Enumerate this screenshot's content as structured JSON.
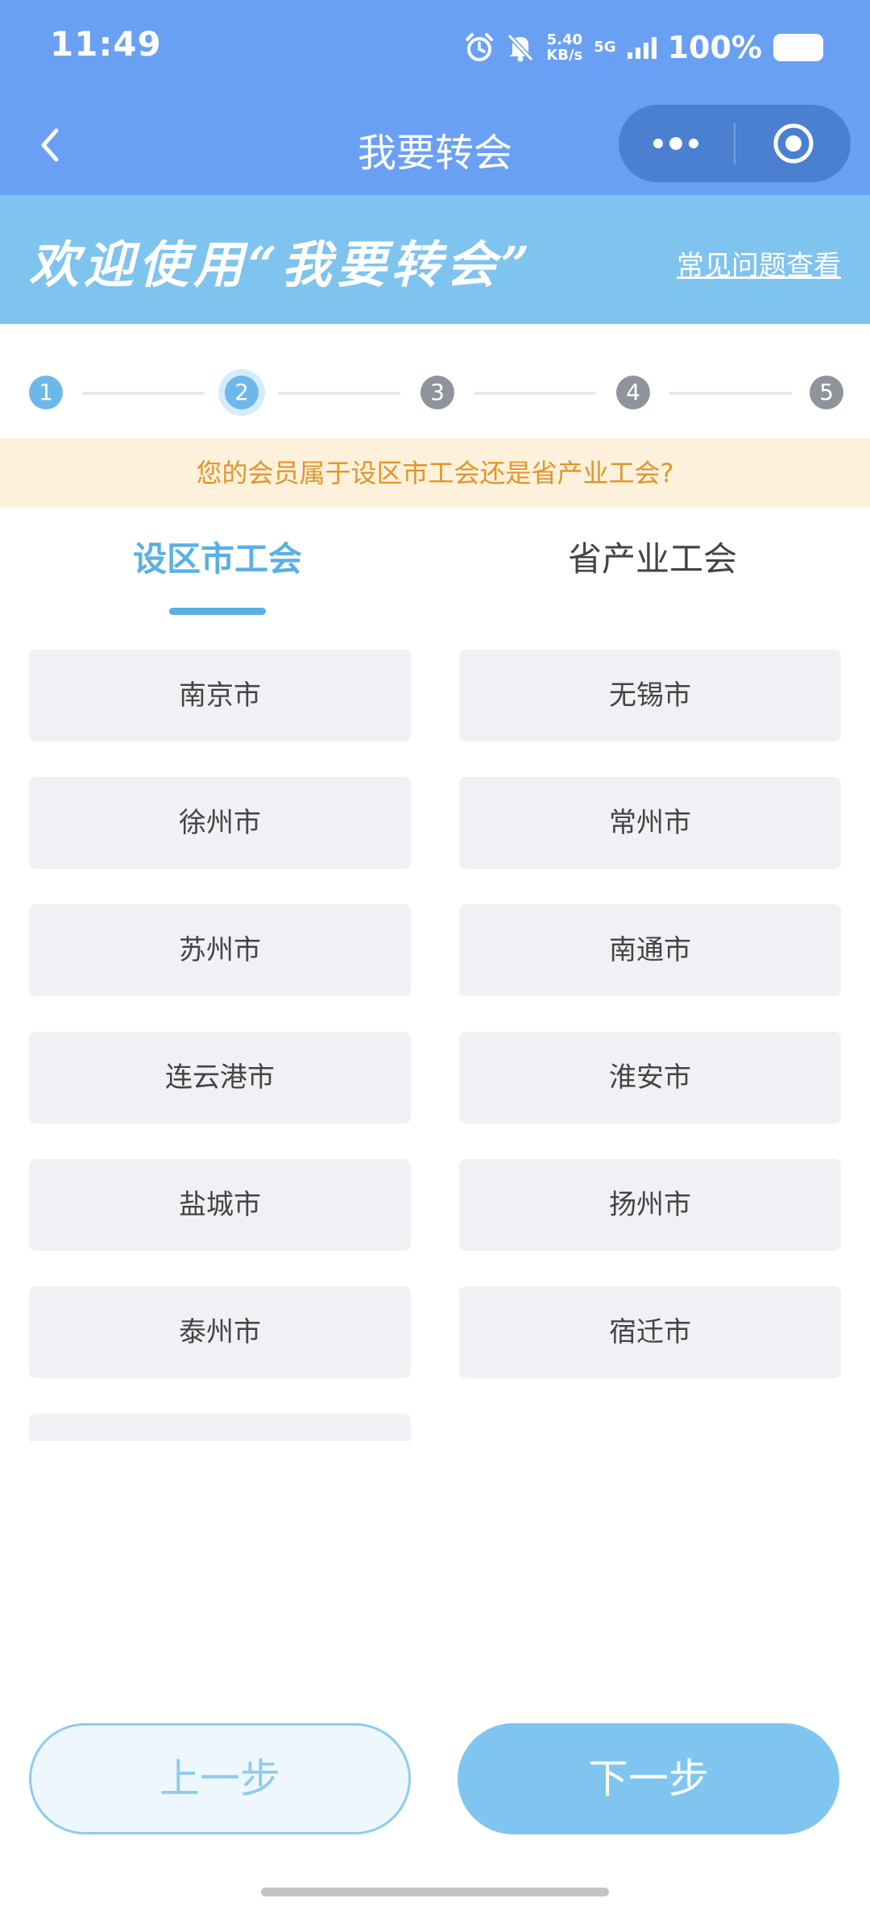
{
  "status_bar": {
    "time": "11:49",
    "speed_value": "5.40",
    "speed_unit": "KB/s",
    "network": "5G",
    "battery": "100%",
    "icons": [
      "alarm-icon",
      "mute-icon",
      "signal-icon",
      "battery-icon"
    ]
  },
  "nav": {
    "title": "我要转会",
    "back_icon": "chevron-left-icon",
    "more_icon": "more-dots-icon",
    "close_icon": "target-circle-icon"
  },
  "banner": {
    "welcome": "欢迎使用“我要转会”",
    "faq_link": "常见问题查看"
  },
  "stepper": {
    "steps": [
      "1",
      "2",
      "3",
      "4",
      "5"
    ],
    "current_step": 2
  },
  "question": "您的会员属于设区市工会还是省产业工会?",
  "tabs": [
    {
      "label": "设区市工会",
      "active": true
    },
    {
      "label": "省产业工会",
      "active": false
    }
  ],
  "cities": [
    "南京市",
    "无锡市",
    "徐州市",
    "常州市",
    "苏州市",
    "南通市",
    "连云港市",
    "淮安市",
    "盐城市",
    "扬州市",
    "泰州市",
    "宿迁市"
  ],
  "buttons": {
    "prev": "上一步",
    "next": "下一步"
  },
  "colors": {
    "header_blue": "#6aa0f4",
    "accent_blue": "#5ab0e4",
    "banner_blue": "#7fc3ef",
    "warning_text": "#e0952a",
    "warning_bg": "#fdf1dc"
  }
}
